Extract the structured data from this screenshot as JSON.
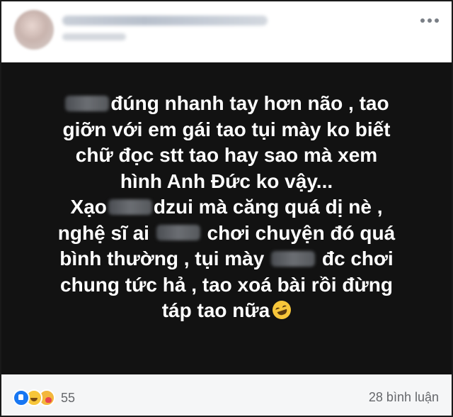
{
  "post": {
    "lines": [
      {
        "before": "",
        "censored": true,
        "after": "đúng nhanh tay hơn não , tao"
      },
      {
        "before": "giỡn với em gái tao tụi mày ko biết",
        "censored": false,
        "after": ""
      },
      {
        "before": "chữ đọc stt tao hay sao mà xem",
        "censored": false,
        "after": ""
      },
      {
        "before": "hình Anh Đức ko vậy...",
        "censored": false,
        "after": ""
      },
      {
        "before": "Xạo",
        "censored": true,
        "after": "dzui mà căng quá dị nè ,"
      },
      {
        "before": "nghệ sĩ ai",
        "censored": true,
        "after": "chơi chuyện đó quá"
      },
      {
        "before": "bình thường ,  tụi mày",
        "censored": true,
        "after": "đc chơi"
      },
      {
        "before": "chung tức hả , tao xoá bài rồi đừng",
        "censored": false,
        "after": ""
      },
      {
        "before": "táp tao nữa",
        "censored": false,
        "after": "",
        "emoji": "rolling-on-floor-laughing"
      }
    ],
    "background_color": "#121212",
    "text_color": "#ffffff"
  },
  "footer": {
    "reaction_icons": [
      "like-icon",
      "haha-icon",
      "care-icon"
    ],
    "reaction_count": "55",
    "comment_count": "28 bình luận"
  }
}
